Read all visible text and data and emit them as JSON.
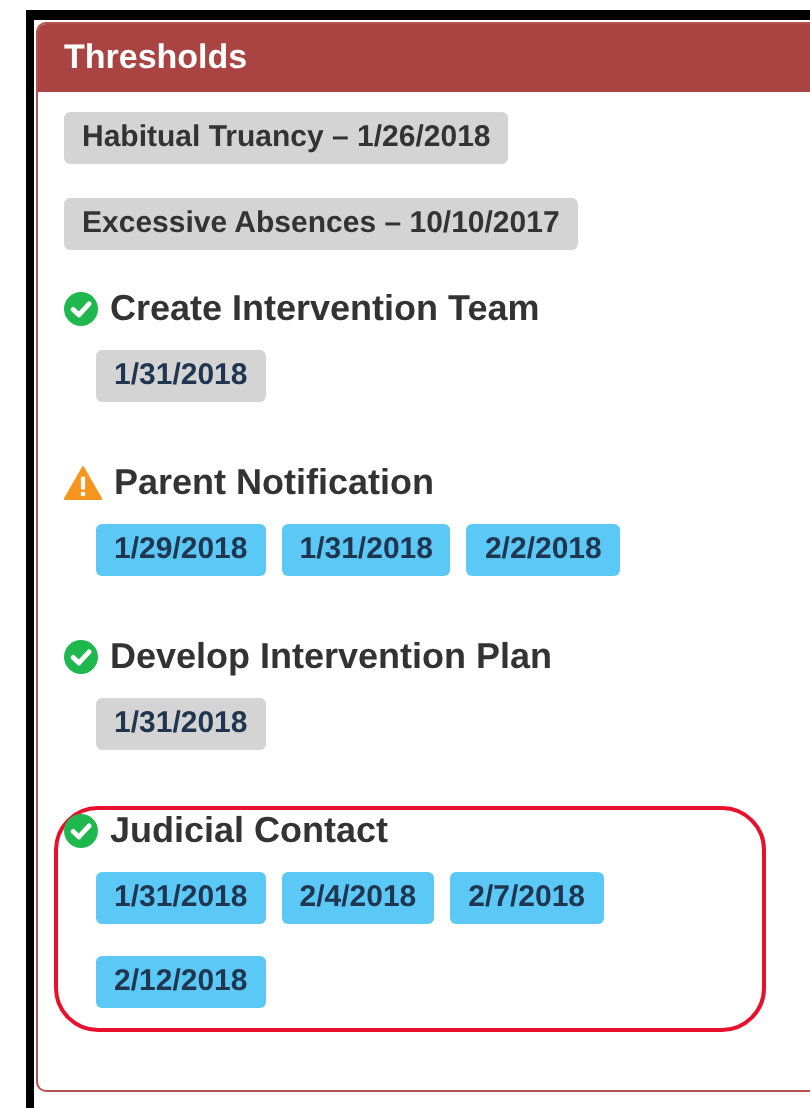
{
  "panel": {
    "title": "Thresholds"
  },
  "thresholds": [
    {
      "label": "Habitual Truancy – 1/26/2018"
    },
    {
      "label": "Excessive Absences – 10/10/2017"
    }
  ],
  "steps": [
    {
      "title": "Create Intervention Team",
      "kind": "complete",
      "highlighted": false,
      "dates": [
        {
          "label": "1/31/2018",
          "color": "#d4d4d4"
        }
      ]
    },
    {
      "title": "Parent Notification",
      "kind": "warning",
      "highlighted": false,
      "dates": [
        {
          "label": "1/29/2018",
          "color": "#5bc8f5"
        },
        {
          "label": "1/31/2018",
          "color": "#5bc8f5"
        },
        {
          "label": "2/2/2018",
          "color": "#5bc8f5"
        }
      ]
    },
    {
      "title": "Develop Intervention Plan",
      "kind": "complete",
      "highlighted": false,
      "dates": [
        {
          "label": "1/31/2018",
          "color": "#d4d4d4"
        }
      ]
    },
    {
      "title": "Judicial Contact",
      "kind": "complete",
      "highlighted": true,
      "dates": [
        {
          "label": "1/31/2018",
          "color": "#5bc8f5"
        },
        {
          "label": "2/4/2018",
          "color": "#5bc8f5"
        },
        {
          "label": "2/7/2018",
          "color": "#5bc8f5"
        },
        {
          "label": "2/12/2018",
          "color": "#5bc8f5"
        }
      ]
    }
  ]
}
